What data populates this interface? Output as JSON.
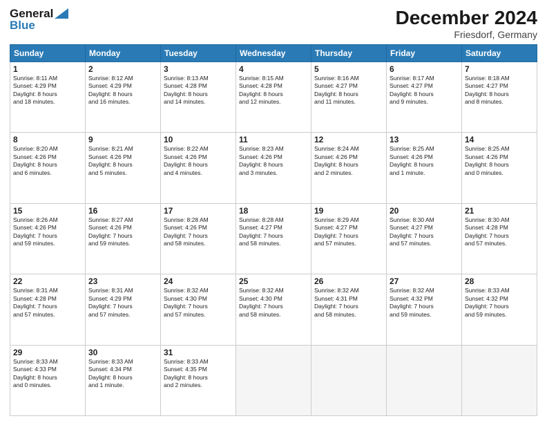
{
  "header": {
    "logo_general": "General",
    "logo_blue": "Blue",
    "main_title": "December 2024",
    "subtitle": "Friesdorf, Germany"
  },
  "columns": [
    "Sunday",
    "Monday",
    "Tuesday",
    "Wednesday",
    "Thursday",
    "Friday",
    "Saturday"
  ],
  "weeks": [
    [
      {
        "day": "1",
        "info": "Sunrise: 8:11 AM\nSunset: 4:29 PM\nDaylight: 8 hours\nand 18 minutes."
      },
      {
        "day": "2",
        "info": "Sunrise: 8:12 AM\nSunset: 4:29 PM\nDaylight: 8 hours\nand 16 minutes."
      },
      {
        "day": "3",
        "info": "Sunrise: 8:13 AM\nSunset: 4:28 PM\nDaylight: 8 hours\nand 14 minutes."
      },
      {
        "day": "4",
        "info": "Sunrise: 8:15 AM\nSunset: 4:28 PM\nDaylight: 8 hours\nand 12 minutes."
      },
      {
        "day": "5",
        "info": "Sunrise: 8:16 AM\nSunset: 4:27 PM\nDaylight: 8 hours\nand 11 minutes."
      },
      {
        "day": "6",
        "info": "Sunrise: 8:17 AM\nSunset: 4:27 PM\nDaylight: 8 hours\nand 9 minutes."
      },
      {
        "day": "7",
        "info": "Sunrise: 8:18 AM\nSunset: 4:27 PM\nDaylight: 8 hours\nand 8 minutes."
      }
    ],
    [
      {
        "day": "8",
        "info": "Sunrise: 8:20 AM\nSunset: 4:26 PM\nDaylight: 8 hours\nand 6 minutes."
      },
      {
        "day": "9",
        "info": "Sunrise: 8:21 AM\nSunset: 4:26 PM\nDaylight: 8 hours\nand 5 minutes."
      },
      {
        "day": "10",
        "info": "Sunrise: 8:22 AM\nSunset: 4:26 PM\nDaylight: 8 hours\nand 4 minutes."
      },
      {
        "day": "11",
        "info": "Sunrise: 8:23 AM\nSunset: 4:26 PM\nDaylight: 8 hours\nand 3 minutes."
      },
      {
        "day": "12",
        "info": "Sunrise: 8:24 AM\nSunset: 4:26 PM\nDaylight: 8 hours\nand 2 minutes."
      },
      {
        "day": "13",
        "info": "Sunrise: 8:25 AM\nSunset: 4:26 PM\nDaylight: 8 hours\nand 1 minute."
      },
      {
        "day": "14",
        "info": "Sunrise: 8:25 AM\nSunset: 4:26 PM\nDaylight: 8 hours\nand 0 minutes."
      }
    ],
    [
      {
        "day": "15",
        "info": "Sunrise: 8:26 AM\nSunset: 4:26 PM\nDaylight: 7 hours\nand 59 minutes."
      },
      {
        "day": "16",
        "info": "Sunrise: 8:27 AM\nSunset: 4:26 PM\nDaylight: 7 hours\nand 59 minutes."
      },
      {
        "day": "17",
        "info": "Sunrise: 8:28 AM\nSunset: 4:26 PM\nDaylight: 7 hours\nand 58 minutes."
      },
      {
        "day": "18",
        "info": "Sunrise: 8:28 AM\nSunset: 4:27 PM\nDaylight: 7 hours\nand 58 minutes."
      },
      {
        "day": "19",
        "info": "Sunrise: 8:29 AM\nSunset: 4:27 PM\nDaylight: 7 hours\nand 57 minutes."
      },
      {
        "day": "20",
        "info": "Sunrise: 8:30 AM\nSunset: 4:27 PM\nDaylight: 7 hours\nand 57 minutes."
      },
      {
        "day": "21",
        "info": "Sunrise: 8:30 AM\nSunset: 4:28 PM\nDaylight: 7 hours\nand 57 minutes."
      }
    ],
    [
      {
        "day": "22",
        "info": "Sunrise: 8:31 AM\nSunset: 4:28 PM\nDaylight: 7 hours\nand 57 minutes."
      },
      {
        "day": "23",
        "info": "Sunrise: 8:31 AM\nSunset: 4:29 PM\nDaylight: 7 hours\nand 57 minutes."
      },
      {
        "day": "24",
        "info": "Sunrise: 8:32 AM\nSunset: 4:30 PM\nDaylight: 7 hours\nand 57 minutes."
      },
      {
        "day": "25",
        "info": "Sunrise: 8:32 AM\nSunset: 4:30 PM\nDaylight: 7 hours\nand 58 minutes."
      },
      {
        "day": "26",
        "info": "Sunrise: 8:32 AM\nSunset: 4:31 PM\nDaylight: 7 hours\nand 58 minutes."
      },
      {
        "day": "27",
        "info": "Sunrise: 8:32 AM\nSunset: 4:32 PM\nDaylight: 7 hours\nand 59 minutes."
      },
      {
        "day": "28",
        "info": "Sunrise: 8:33 AM\nSunset: 4:32 PM\nDaylight: 7 hours\nand 59 minutes."
      }
    ],
    [
      {
        "day": "29",
        "info": "Sunrise: 8:33 AM\nSunset: 4:33 PM\nDaylight: 8 hours\nand 0 minutes."
      },
      {
        "day": "30",
        "info": "Sunrise: 8:33 AM\nSunset: 4:34 PM\nDaylight: 8 hours\nand 1 minute."
      },
      {
        "day": "31",
        "info": "Sunrise: 8:33 AM\nSunset: 4:35 PM\nDaylight: 8 hours\nand 2 minutes."
      },
      {
        "day": "",
        "info": ""
      },
      {
        "day": "",
        "info": ""
      },
      {
        "day": "",
        "info": ""
      },
      {
        "day": "",
        "info": ""
      }
    ]
  ]
}
